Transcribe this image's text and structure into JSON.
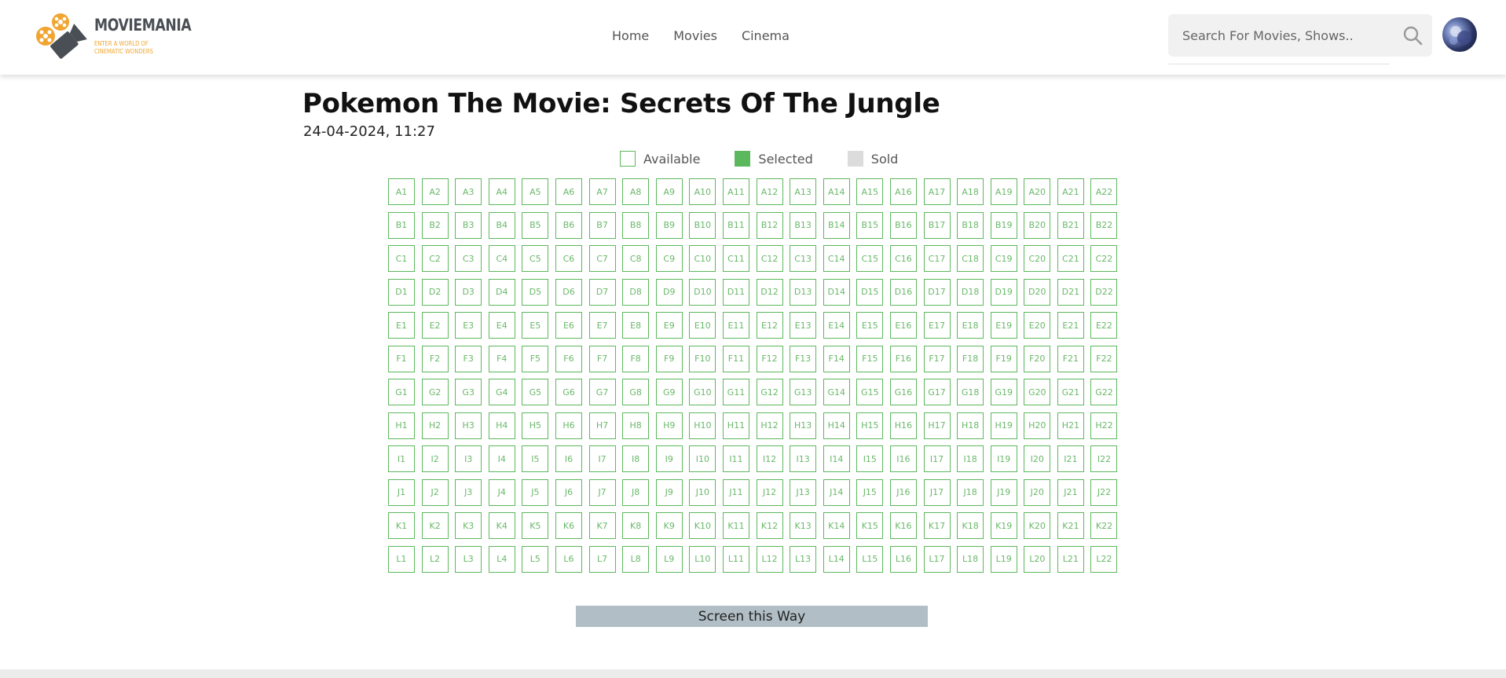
{
  "brand": {
    "name": "MOVIEMANIA",
    "tagline": "ENTER A WORLD OF CINEMATIC WONDERS",
    "accent": "#f0a531",
    "dark": "#4a4f55"
  },
  "nav": {
    "items": [
      {
        "label": "Home"
      },
      {
        "label": "Movies"
      },
      {
        "label": "Cinema"
      }
    ]
  },
  "search": {
    "placeholder": "Search For Movies, Shows..",
    "value": "",
    "icon": "search-icon"
  },
  "user": {
    "avatar_icon": "avatar"
  },
  "movie": {
    "title": "Pokemon The Movie: Secrets Of The Jungle",
    "showtime": "24-04-2024, 11:27"
  },
  "legend": {
    "available": "Available",
    "selected": "Selected",
    "sold": "Sold"
  },
  "colors": {
    "available_border": "#5cb85c",
    "selected": "#5cb85c",
    "sold": "#dcdcdc",
    "screen": "#b1bec5"
  },
  "seating": {
    "rows": [
      "A",
      "B",
      "C",
      "D",
      "E",
      "F",
      "G",
      "H",
      "I",
      "J",
      "K",
      "L"
    ],
    "seats_per_row": 22,
    "status": "available"
  },
  "screen_label": "Screen this Way"
}
